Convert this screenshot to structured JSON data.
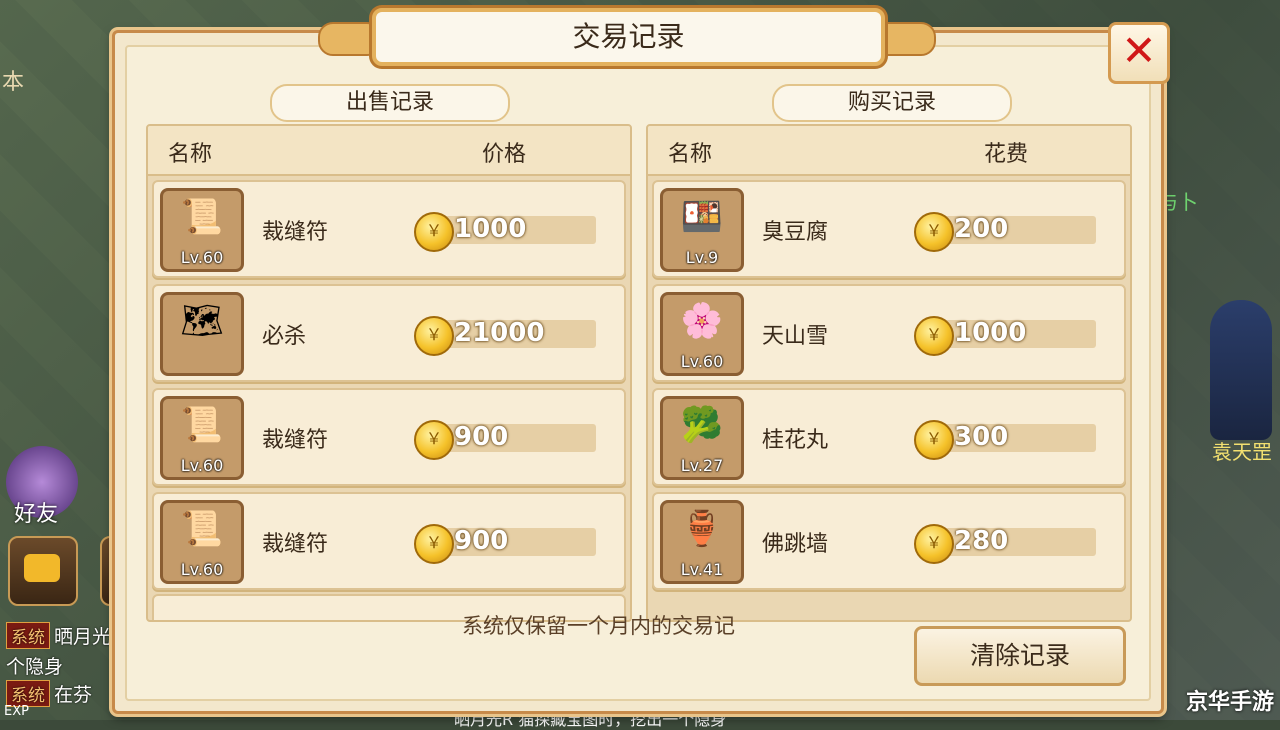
{
  "dialog": {
    "title": "交易记录",
    "close_label": "✕"
  },
  "background": {
    "left_glyph": "本",
    "npc_name": "袁天罡",
    "right_fragment": "与卜",
    "friend_label": "好友"
  },
  "chat": {
    "lines": [
      {
        "tag": "系统",
        "text": "晒月光"
      },
      {
        "tag": "",
        "text": "个隐身"
      },
      {
        "tag": "系统",
        "text": "在芬"
      }
    ],
    "exp_label": "EXP",
    "bottom_text": "晒月光R 猫探藏宝图时，挖出一个隐身"
  },
  "sell": {
    "tab_label": "出售记录",
    "col_name": "名称",
    "col_price": "价格",
    "rows": [
      {
        "icon": "scroll-icon",
        "level": "Lv.60",
        "name": "裁缝符",
        "price": "1000"
      },
      {
        "icon": "map-scroll-icon",
        "level": "",
        "name": "必杀",
        "price": "21000"
      },
      {
        "icon": "scroll-icon",
        "level": "Lv.60",
        "name": "裁缝符",
        "price": "900"
      },
      {
        "icon": "scroll-icon",
        "level": "Lv.60",
        "name": "裁缝符",
        "price": "900"
      }
    ]
  },
  "buy": {
    "tab_label": "购买记录",
    "col_name": "名称",
    "col_cost": "花费",
    "rows": [
      {
        "icon": "tofu-dish-icon",
        "level": "Lv.9",
        "name": "臭豆腐",
        "price": "200"
      },
      {
        "icon": "lotus-flower-icon",
        "level": "Lv.60",
        "name": "天山雪",
        "price": "1000"
      },
      {
        "icon": "osmanthus-ball-icon",
        "level": "Lv.27",
        "name": "桂花丸",
        "price": "300"
      },
      {
        "icon": "jar-pot-icon",
        "level": "Lv.41",
        "name": "佛跳墙",
        "price": "280"
      }
    ]
  },
  "footer": {
    "note": "系统仅保留一个月内的交易记",
    "clear_button": "清除记录"
  },
  "watermark": "京华手游",
  "colors": {
    "accent": "#c78a4a",
    "panel": "#f3e7cc",
    "close": "#d01818",
    "coin": "#f5c22a"
  }
}
